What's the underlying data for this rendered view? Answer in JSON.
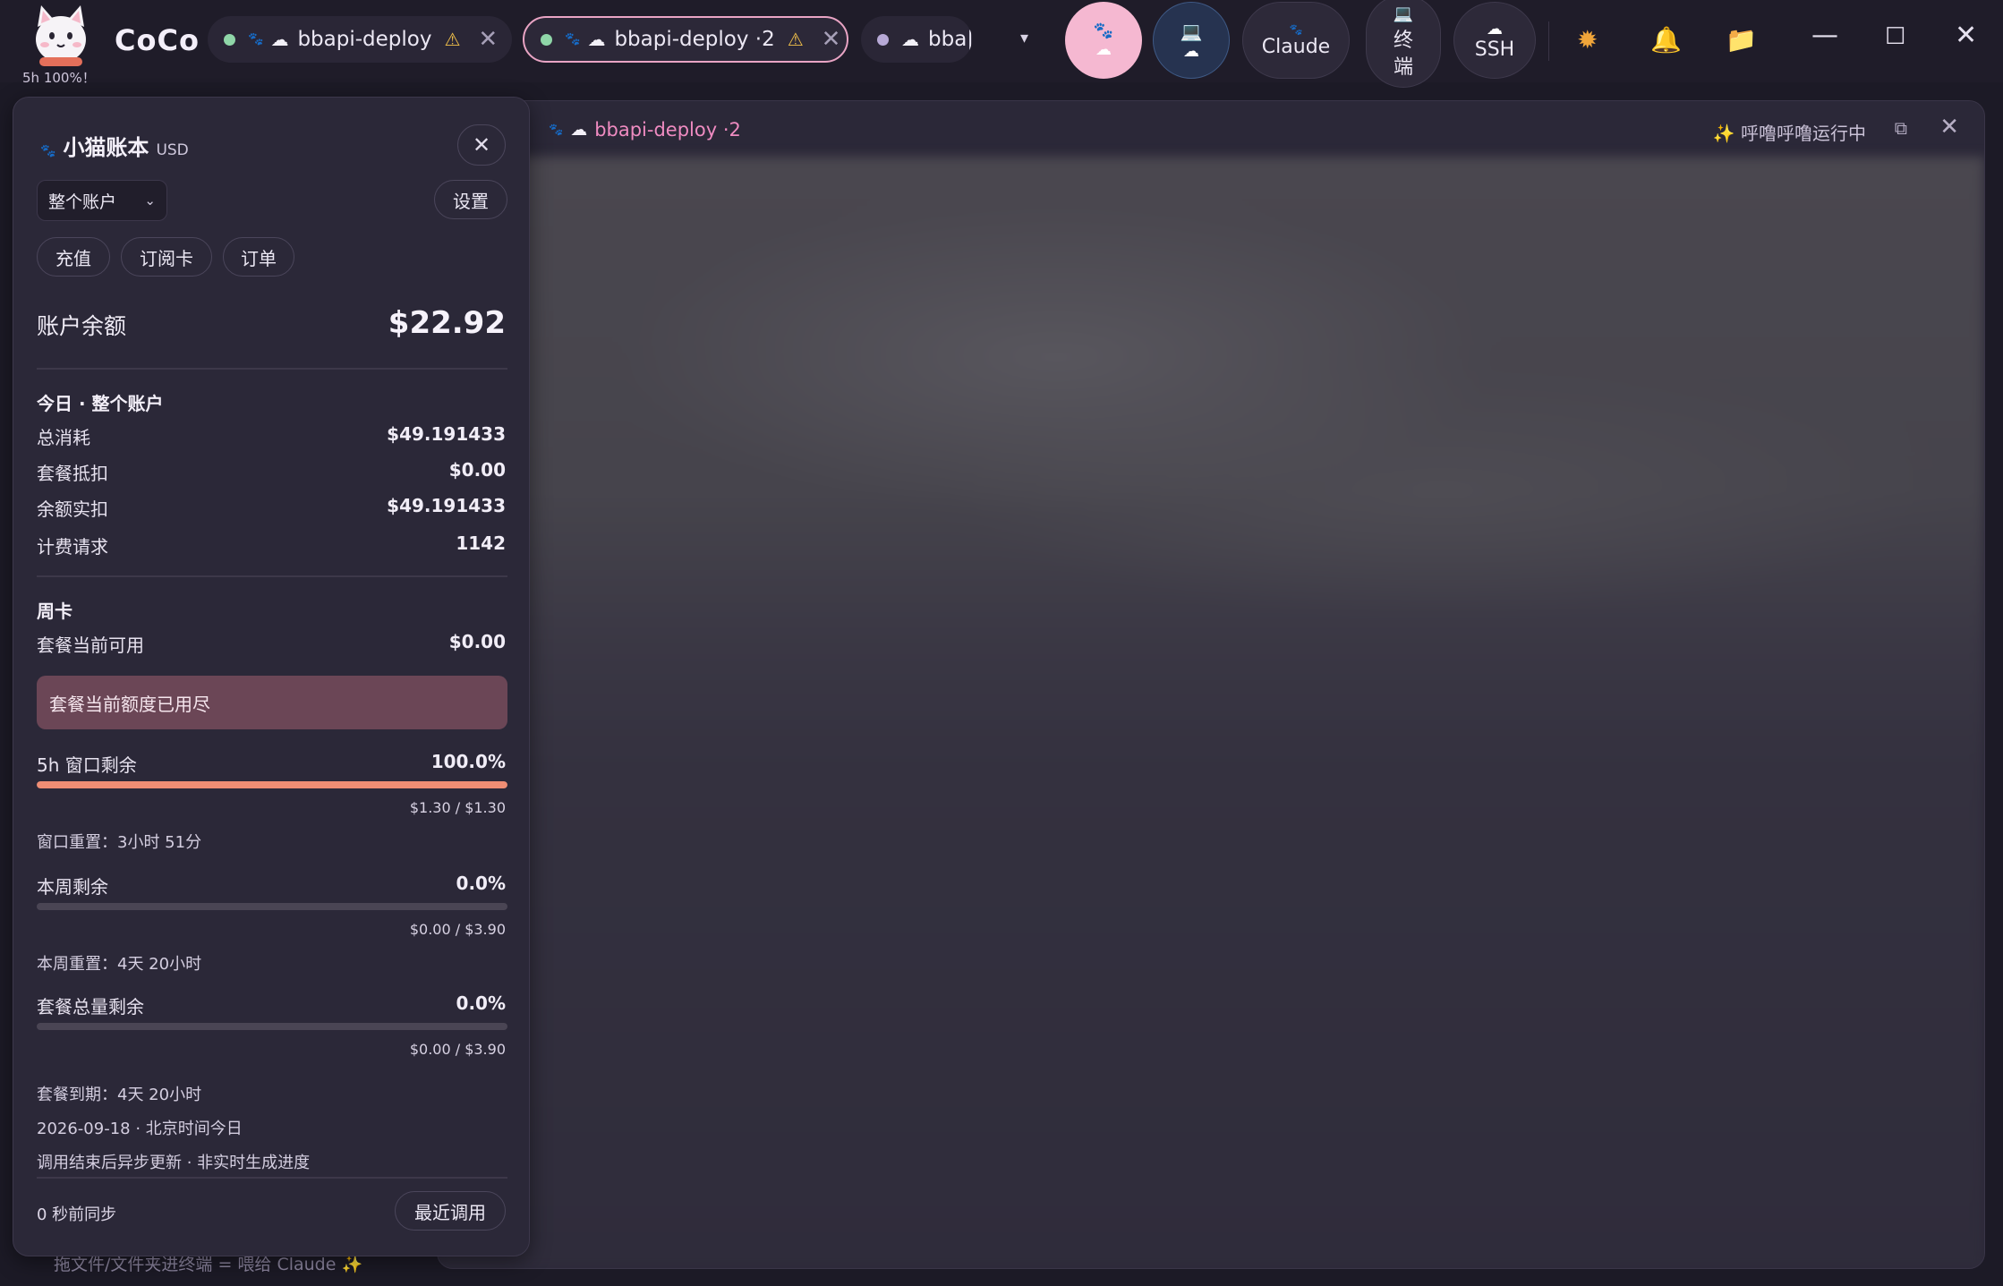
{
  "app": {
    "name": "CoCo",
    "status": "5h 100%！"
  },
  "tabs": [
    {
      "label": "bbapi-deploy",
      "dot_color": "#8fd6a8",
      "warning": "⚠",
      "close": "✕"
    },
    {
      "label": "bbapi-deploy ·2",
      "dot_color": "#8fd6a8",
      "warning": "⚠",
      "close": "✕"
    },
    {
      "label": "bba|",
      "dot_color": "#b7a9d6"
    }
  ],
  "tab_dropdown": "▾",
  "toolbar": {
    "paw_icon": "paw-icon",
    "laptop_icon": "laptop-icon",
    "claude_label": "Claude",
    "terminal_label_1": "终",
    "terminal_label_2": "端",
    "ssh_label": "SSH"
  },
  "main": {
    "title": "bbapi-deploy ·2",
    "status": "✨ 呼噜呼噜运行中",
    "footer_hint": "拖文件/文件夹进终端 = 喂给 Claude ✨"
  },
  "account": {
    "title": "小猫账本",
    "currency": "USD",
    "scope_select": "整个账户",
    "settings_label": "设置",
    "topup_label": "充值",
    "subscription_label": "订阅卡",
    "orders_label": "订单",
    "balance_label": "账户余额",
    "balance_value": "$22.92",
    "today": {
      "title": "今日 · 整个账户",
      "rows": [
        {
          "label": "总消耗",
          "value": "$49.191433"
        },
        {
          "label": "套餐抵扣",
          "value": "$0.00"
        },
        {
          "label": "余额实扣",
          "value": "$49.191433"
        },
        {
          "label": "计费请求",
          "value": "1142"
        }
      ]
    },
    "weekly": {
      "title": "周卡",
      "available_label": "套餐当前可用",
      "available_value": "$0.00",
      "notice": "套餐当前额度已用尽",
      "window": {
        "label": "5h 窗口剩余",
        "percent": "100.0%",
        "fraction": 1.0,
        "sub": "$1.30 / $1.30",
        "reset": "窗口重置：3小时 51分"
      },
      "week": {
        "label": "本周剩余",
        "percent": "0.0%",
        "fraction": 0.0,
        "sub": "$0.00 / $3.90",
        "reset": "本周重置：4天 20小时"
      },
      "total": {
        "label": "套餐总量剩余",
        "percent": "0.0%",
        "fraction": 0.0,
        "sub": "$0.00 / $3.90"
      },
      "expiry": "套餐到期：4天 20小时",
      "date_line": "2026-09-18 · 北京时间今日",
      "update_note": "调用结束后异步更新 · 非实时生成进度"
    },
    "sync_text": "0 秒前同步",
    "recent_calls_label": "最近调用"
  },
  "colors": {
    "accent_pink": "#ef8bc1",
    "bar_fill": "#ef8d74",
    "notice_bg": "#6b4656"
  }
}
